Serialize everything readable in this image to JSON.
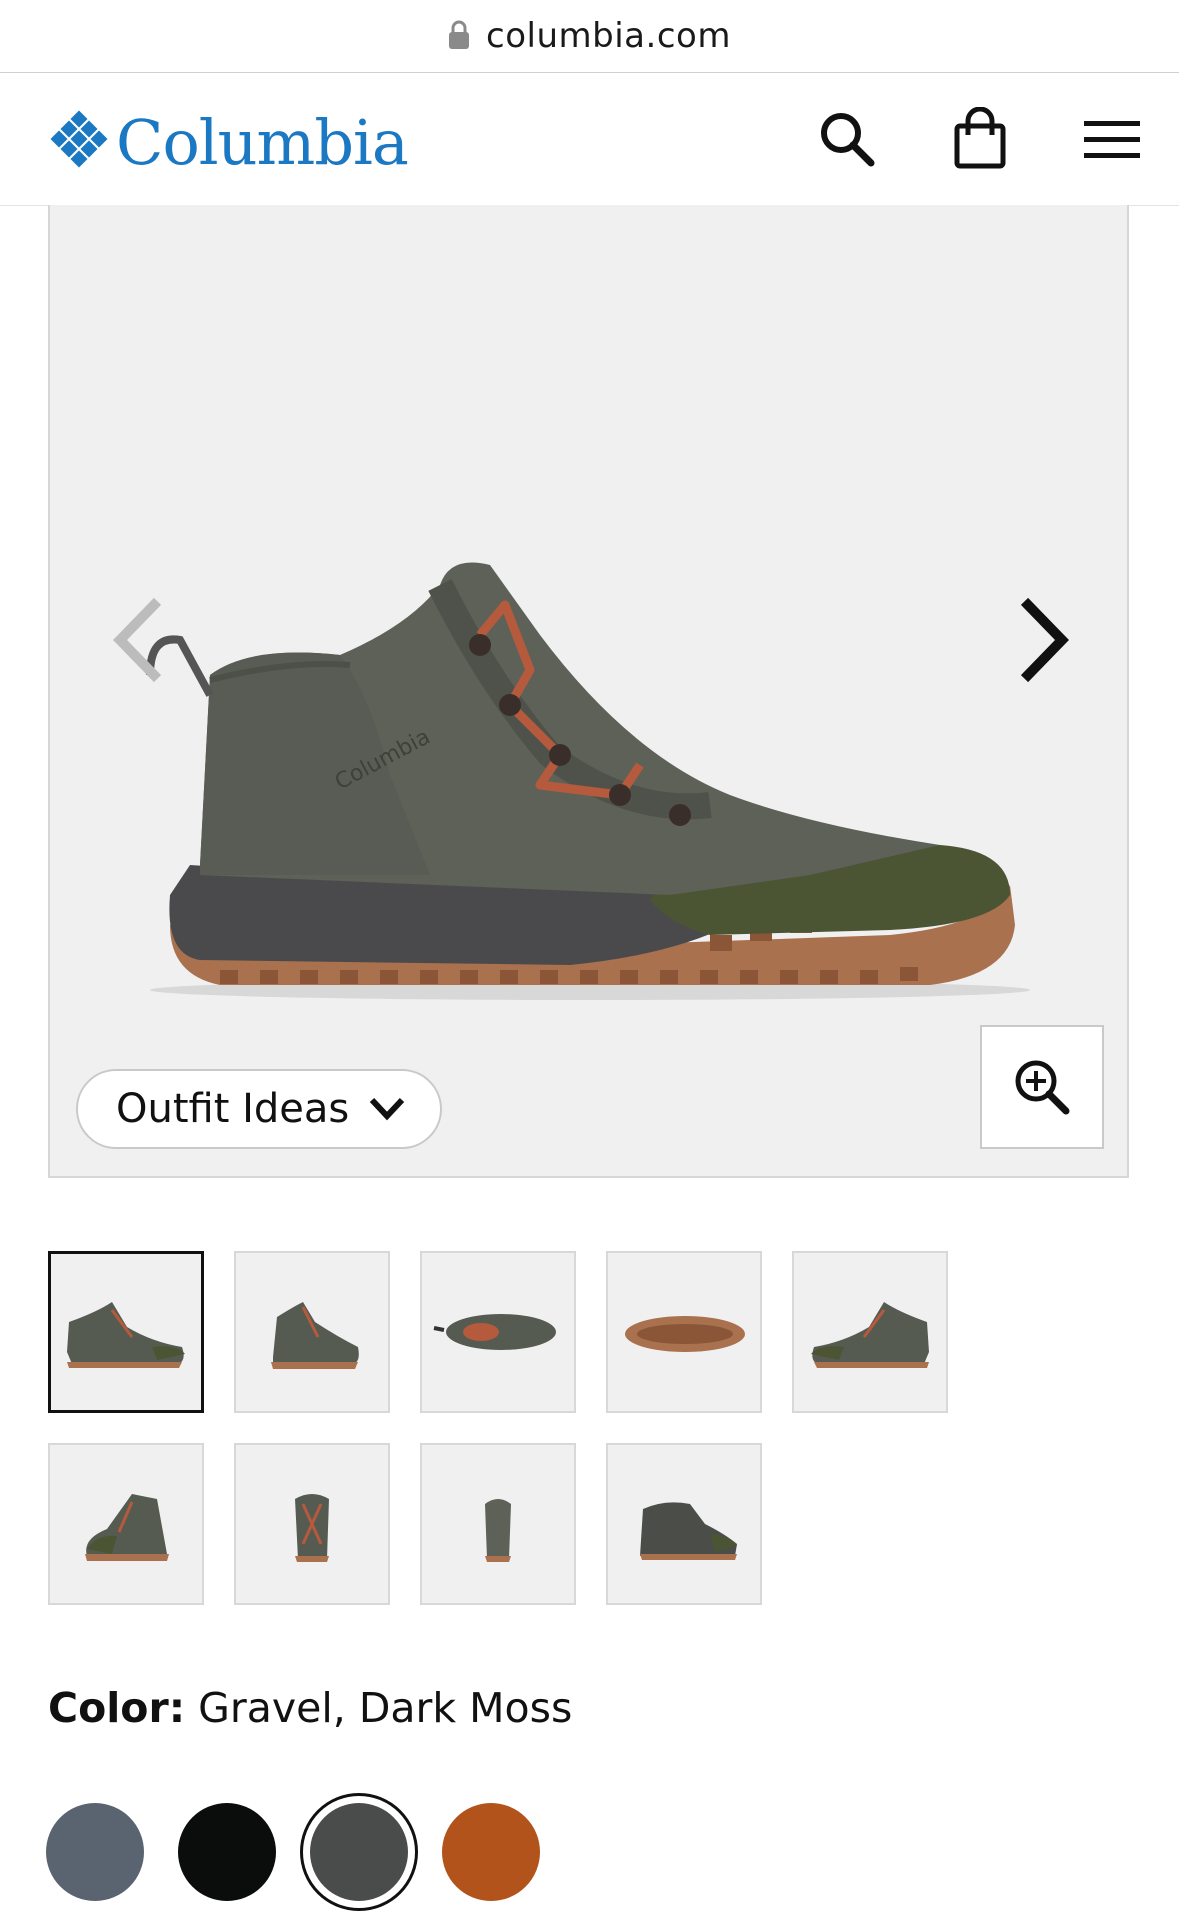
{
  "browser": {
    "url": "columbia.com",
    "lock_icon": "lock-icon"
  },
  "header": {
    "brand": "Columbia",
    "icons": [
      "search-icon",
      "shopping-bag-icon",
      "hamburger-menu-icon"
    ]
  },
  "hero": {
    "image": "boot-side-view",
    "outfit_label": "Outfit Ideas",
    "prev_icon": "chevron-left-icon",
    "next_icon": "chevron-right-icon",
    "zoom_icon": "zoom-in-icon"
  },
  "thumbnails": [
    {
      "view": "side-left",
      "active": true
    },
    {
      "view": "three-quarter",
      "active": false
    },
    {
      "view": "top-down",
      "active": false
    },
    {
      "view": "outsole",
      "active": false
    },
    {
      "view": "side-right",
      "active": false
    },
    {
      "view": "front-three-quarter",
      "active": false
    },
    {
      "view": "front",
      "active": false
    },
    {
      "view": "back",
      "active": false
    },
    {
      "view": "inner-three-quarter",
      "active": false
    }
  ],
  "color": {
    "label": "Color:",
    "value": "Gravel, Dark Moss",
    "swatches": [
      {
        "hex": "#5a6470",
        "selected": false
      },
      {
        "hex": "#0b0d0c",
        "selected": false
      },
      {
        "hex": "#4a4c4b",
        "selected": true
      },
      {
        "hex": "#b2531c",
        "selected": false
      }
    ]
  }
}
